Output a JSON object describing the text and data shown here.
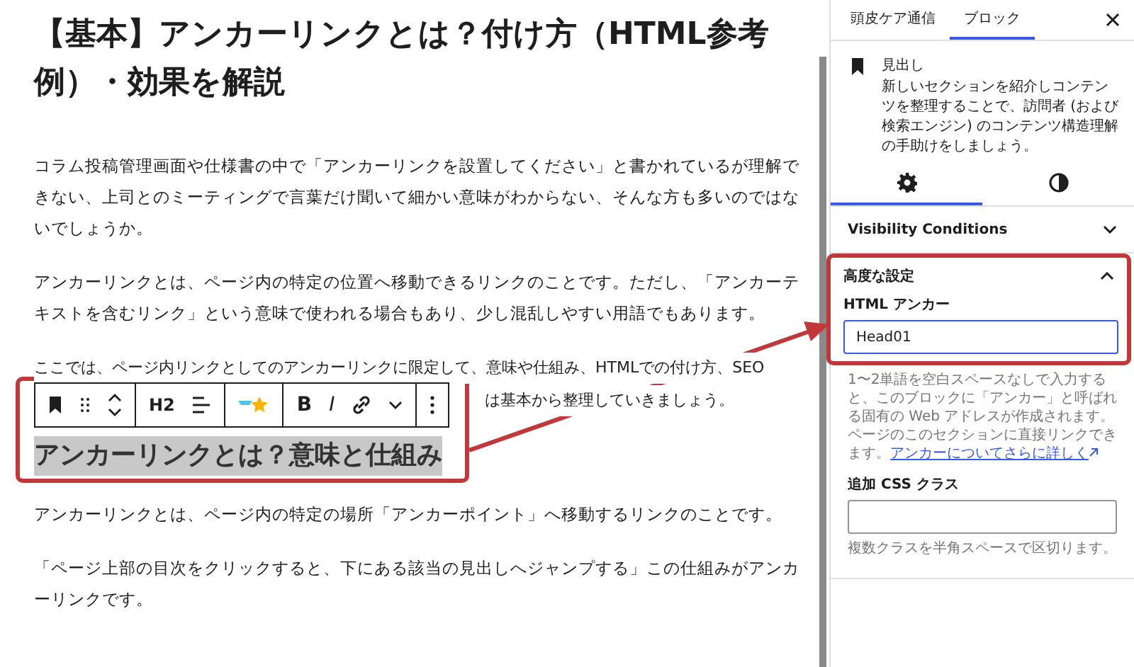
{
  "post_title": "【基本】アンカーリンクとは？付け方（HTML参考例）・効果を解説",
  "paragraphs_before": [
    "コラム投稿管理画面や仕様書の中で「アンカーリンクを設置してください」と書かれているが理解できない、上司とのミーティングで言葉だけ聞いて細かい意味がわからない、そんな方も多いのではないでしょうか。",
    "アンカーリンクとは、ページ内の特定の位置へ移動できるリンクのことです。ただし、「アンカーテキストを含むリンク」という意味で使われる場合もあり、少し混乱しやすい用語でもあります。"
  ],
  "partial_paragraph": {
    "line_1": "ここでは、ページ内リンクとしてのアンカーリンクに限定して、意味や仕組み、HTMLでの付け方、SEO",
    "visible_tail": "は基本から整理していきましょう。"
  },
  "toolbar": {
    "heading_level": "H2",
    "bold": "B",
    "italic": "I"
  },
  "selected_heading": {
    "text": "アンカーリンクとは？意味と仕組み",
    "selected": true
  },
  "paragraphs_after": [
    "アンカーリンクとは、ページ内の特定の場所「アンカーポイント」へ移動するリンクのことです。",
    "「ページ上部の目次をクリックすると、下にある該当の見出しへジャンプする」この仕組みがアンカーリンクです。"
  ],
  "sidebar": {
    "tabs": [
      {
        "label": "頭皮ケア通信",
        "selected": false
      },
      {
        "label": "ブロック",
        "selected": true
      }
    ],
    "block": {
      "name": "見出し",
      "description": "新しいセクションを紹介しコンテンツを整理することで、訪問者 (および検索エンジン) のコンテンツ構造理解の手助けをしましょう。"
    },
    "subtabs": [
      {
        "kind": "settings",
        "selected": true
      },
      {
        "kind": "styles",
        "selected": false
      }
    ],
    "panels": [
      {
        "title": "Visibility Conditions",
        "expanded": false
      },
      {
        "title": "高度な設定",
        "expanded": true
      }
    ],
    "anchor_label": "HTML アンカー",
    "anchor_value": "Head01",
    "anchor_help": "1〜2単語を空白スペースなしで入力すると、このブロックに「アンカー」と呼ばれる固有の Web アドレスが作成されます。ページのこのセクションに直接リンクできます。",
    "anchor_link": "アンカーについてさらに詳しく",
    "css_label": "追加 CSS クラス",
    "css_help": "複数クラスを半角スペースで区切ります。"
  }
}
